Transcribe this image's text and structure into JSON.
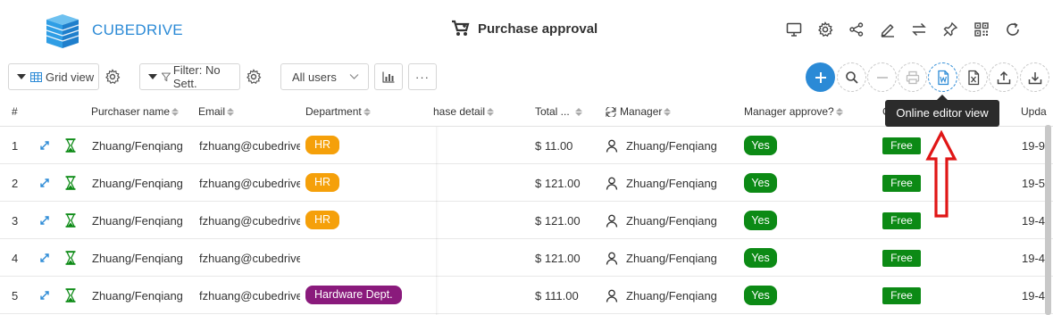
{
  "header": {
    "brand": "CUBEDRIVE",
    "title": "Purchase approval",
    "icons": [
      "desktop-icon",
      "gear-icon",
      "share-icon",
      "edit-icon",
      "swap-icon",
      "pin-icon",
      "qrcode-icon",
      "refresh-icon"
    ]
  },
  "toolbar": {
    "grid_view_label": "Grid view",
    "filter_label": "Filter: No Sett.",
    "users_select": "All users",
    "more_label": "···"
  },
  "tooltip": "Online editor view",
  "colors": {
    "brand": "#2b8ad6",
    "yes": "#0c8a15",
    "hr_tag": "#f5a00a",
    "hardware_tag": "#8a1a7c",
    "arrow": "#e01616"
  },
  "grid": {
    "columns": {
      "num": "#",
      "purchaser": "Purchaser name",
      "email": "Email",
      "department": "Department",
      "purchase_detail": "hase detail",
      "total": "Total ...",
      "manager": "Manager",
      "manager_approve": "Manager approve?",
      "free_col": "C",
      "updated": "Upda"
    },
    "rows": [
      {
        "num": "1",
        "purchaser": "Zhuang/Fenqiang",
        "email": "fzhuang@cubedrive",
        "department": "HR",
        "total": "$ 11.00",
        "manager": "Zhuang/Fenqiang",
        "approve": "Yes",
        "free": "Free",
        "updated": "19-9"
      },
      {
        "num": "2",
        "purchaser": "Zhuang/Fenqiang",
        "email": "fzhuang@cubedrive",
        "department": "HR",
        "total": "$ 121.00",
        "manager": "Zhuang/Fenqiang",
        "approve": "Yes",
        "free": "Free",
        "updated": "19-5"
      },
      {
        "num": "3",
        "purchaser": "Zhuang/Fenqiang",
        "email": "fzhuang@cubedrive",
        "department": "HR",
        "total": "$ 121.00",
        "manager": "Zhuang/Fenqiang",
        "approve": "Yes",
        "free": "Free",
        "updated": "19-4"
      },
      {
        "num": "4",
        "purchaser": "Zhuang/Fenqiang",
        "email": "fzhuang@cubedrive",
        "department": "",
        "total": "$ 121.00",
        "manager": "Zhuang/Fenqiang",
        "approve": "Yes",
        "free": "Free",
        "updated": "19-4"
      },
      {
        "num": "5",
        "purchaser": "Zhuang/Fenqiang",
        "email": "fzhuang@cubedrive",
        "department": "Hardware Dept.",
        "total": "$ 111.00",
        "manager": "Zhuang/Fenqiang",
        "approve": "Yes",
        "free": "Free",
        "updated": "19-4"
      }
    ]
  }
}
